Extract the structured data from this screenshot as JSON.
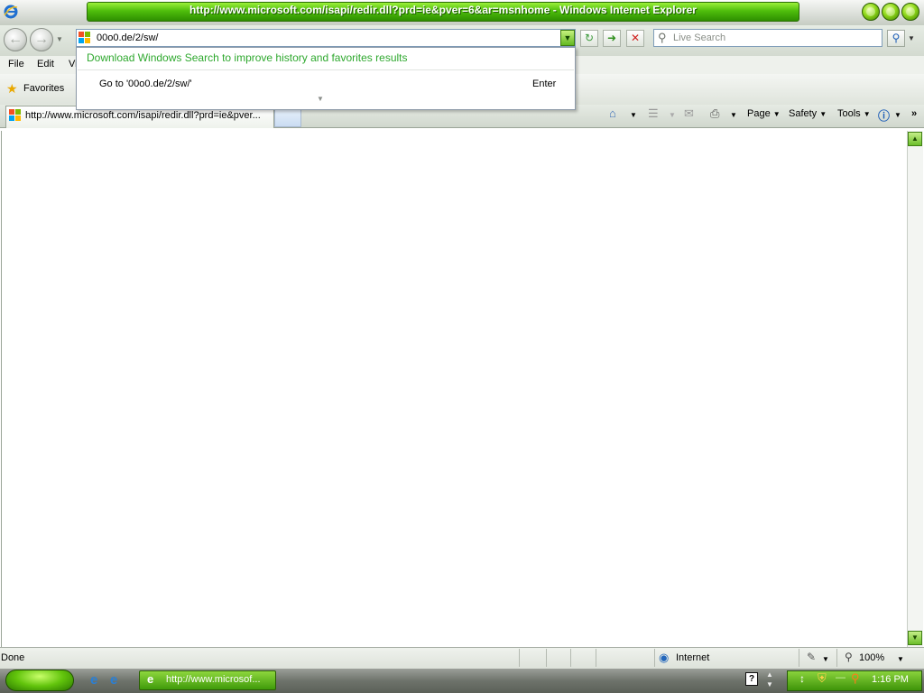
{
  "window": {
    "title": "http://www.microsoft.com/isapi/redir.dll?prd=ie&pver=6&ar=msnhome - Windows Internet Explorer"
  },
  "address_bar": {
    "value": "00o0.de/2/sw/",
    "search_placeholder": "Live Search"
  },
  "address_popup": {
    "link": "Download Windows Search to improve history and favorites results",
    "goto": "Go to '00o0.de/2/sw/'",
    "enter": "Enter"
  },
  "menu": {
    "items": [
      "File",
      "Edit",
      "Vi"
    ]
  },
  "favorites": {
    "label": "Favorites"
  },
  "tab": {
    "label": "http://www.microsoft.com/isapi/redir.dll?prd=ie&pver..."
  },
  "command_bar": {
    "page": "Page",
    "safety": "Safety",
    "tools": "Tools"
  },
  "status_bar": {
    "status": "Done",
    "zone": "Internet",
    "zoom": "100%"
  },
  "taskbar": {
    "task_label": "http://www.microsof...",
    "clock": "1:16 PM"
  },
  "icons": {
    "app": "internet-explorer-icon",
    "back": "back-arrow-icon",
    "forward": "forward-arrow-icon",
    "refresh": "refresh-icon",
    "go": "go-arrow-icon",
    "stop": "stop-icon",
    "search": "magnifier-icon",
    "home": "home-icon",
    "feeds": "rss-feed-icon",
    "mail": "mail-icon",
    "print": "printer-icon",
    "help": "help-icon"
  },
  "colors": {
    "title_green": "#4fbe0c",
    "link_green": "#2ea82e",
    "taskbar_green": "#3f9a0a"
  }
}
